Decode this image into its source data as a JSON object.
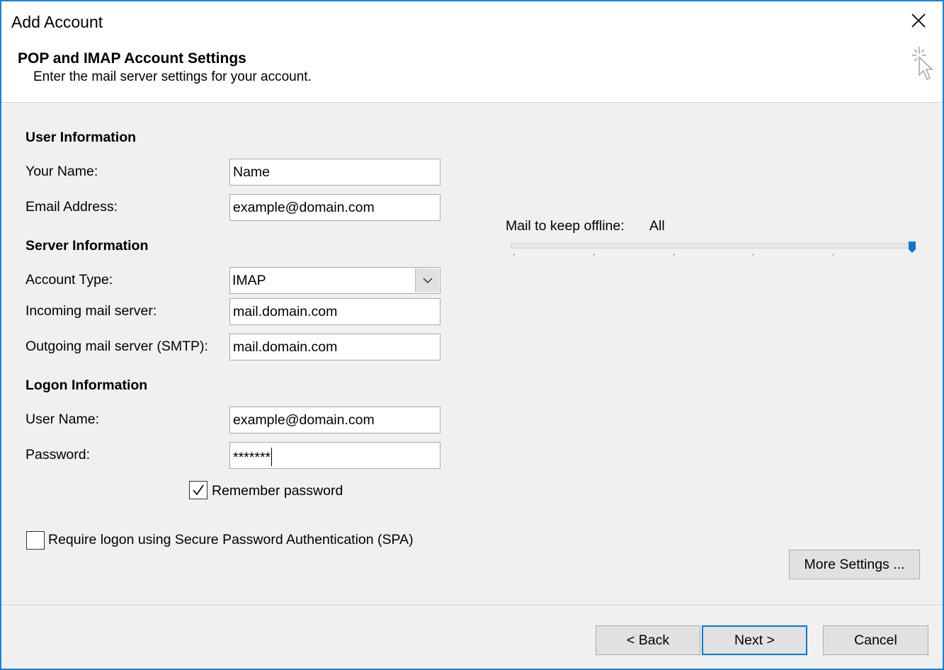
{
  "window": {
    "title": "Add Account"
  },
  "header": {
    "title": "POP and IMAP Account Settings",
    "subtitle": "Enter the mail server settings for your account."
  },
  "user_info": {
    "section": "User Information",
    "name_label": "Your Name:",
    "name_value": "Name",
    "email_label": "Email Address:",
    "email_value": "example@domain.com"
  },
  "server_info": {
    "section": "Server Information",
    "account_type_label": "Account Type:",
    "account_type_value": "IMAP",
    "incoming_label": "Incoming mail server:",
    "incoming_value": "mail.domain.com",
    "outgoing_label": "Outgoing mail server (SMTP):",
    "outgoing_value": "mail.domain.com"
  },
  "logon_info": {
    "section": "Logon Information",
    "username_label": "User Name:",
    "username_value": "example@domain.com",
    "password_label": "Password:",
    "password_value": "*******",
    "remember_label": "Remember password",
    "remember_checked": true,
    "spa_label": "Require logon using Secure Password Authentication (SPA)",
    "spa_checked": false
  },
  "offline": {
    "label": "Mail to keep offline:",
    "value": "All",
    "slider_level_fraction": 1.0
  },
  "buttons": {
    "more_settings": "More Settings ...",
    "back": "< Back",
    "next": "Next >",
    "cancel": "Cancel"
  },
  "colors": {
    "accent": "#0078d7",
    "window_border": "#1883d7",
    "slider_thumb": "#0078d7"
  },
  "icons": {
    "close": "close-icon",
    "wizard": "cursor-sparkle-icon",
    "dropdown": "chevron-down-icon",
    "check": "checkmark-icon"
  }
}
